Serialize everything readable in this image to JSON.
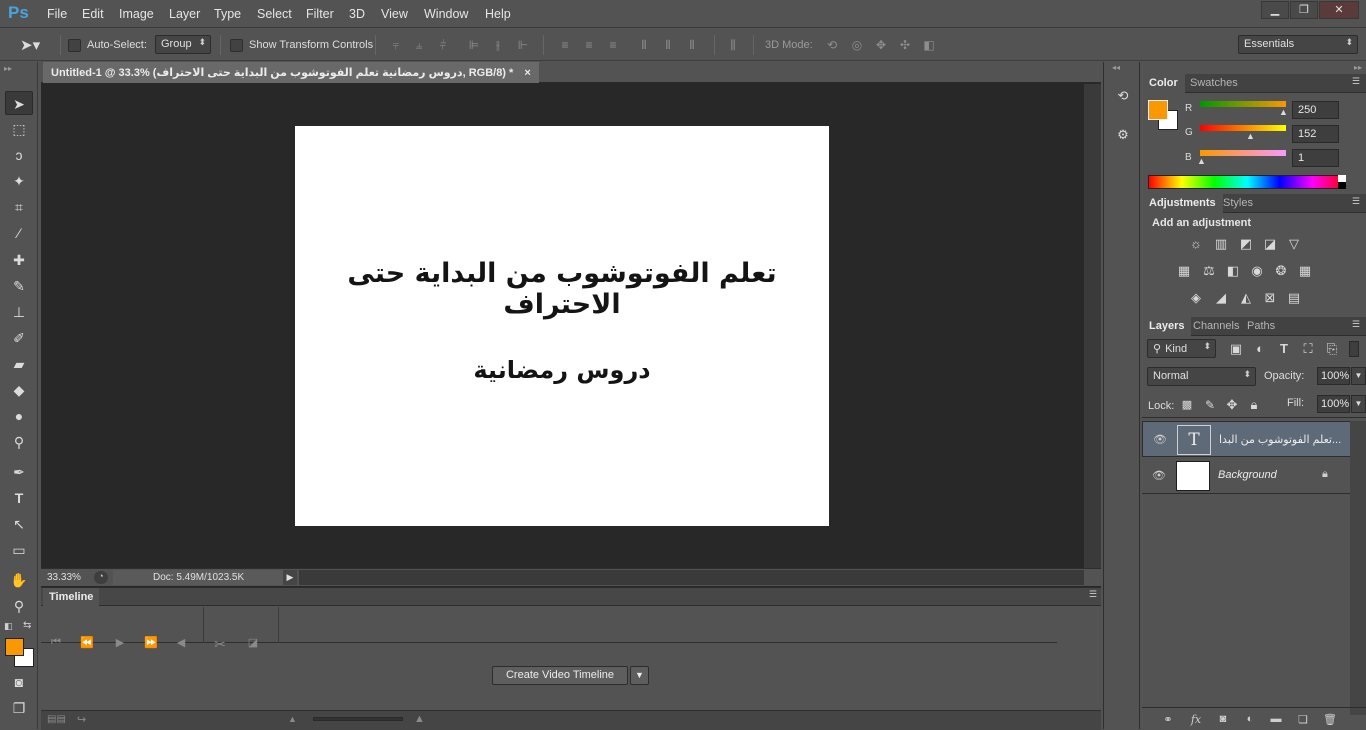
{
  "app": {
    "logo": "Ps",
    "menu": [
      "File",
      "Edit",
      "Image",
      "Layer",
      "Type",
      "Select",
      "Filter",
      "3D",
      "View",
      "Window",
      "Help"
    ],
    "window_controls": [
      "▁",
      "❐",
      "✕"
    ]
  },
  "options": {
    "auto_select_label": "Auto-Select:",
    "auto_select_value": "Group",
    "show_transform_label": "Show Transform Controls",
    "mode_3d_label": "3D Mode:",
    "workspace": "Essentials"
  },
  "document": {
    "tab_title": "Untitled-1 @ 33.3% (دروس رمضانية  تعلم الفوتوشوب من البداية حتى الاحتراف, RGB/8) *",
    "tab_close": "×",
    "canvas_title": "تعلم الفوتوشوب من البداية حتى الاحتراف",
    "canvas_subtitle": "دروس رمضانية",
    "zoom": "33.33%",
    "doc_info": "Doc: 5.49M/1023.5K"
  },
  "timeline": {
    "tab": "Timeline",
    "create_button": "Create Video Timeline"
  },
  "color_panel": {
    "tabs": [
      "Color",
      "Swatches"
    ],
    "foreground": "#fa9801",
    "background": "#ffffff",
    "r_label": "R",
    "g_label": "G",
    "b_label": "B",
    "r": "250",
    "g": "152",
    "b": "1"
  },
  "adjustments_panel": {
    "tabs": [
      "Adjustments",
      "Styles"
    ],
    "heading": "Add an adjustment"
  },
  "layers_panel": {
    "tabs": [
      "Layers",
      "Channels",
      "Paths"
    ],
    "filter_kind": "Kind",
    "blend_mode": "Normal",
    "opacity_label": "Opacity:",
    "opacity": "100%",
    "lock_label": "Lock:",
    "fill_label": "Fill:",
    "fill": "100%",
    "layers": [
      {
        "name": "تعلم الفوتوشوب من البدا...",
        "type": "text",
        "thumb": "T"
      },
      {
        "name": "Background",
        "type": "background"
      }
    ]
  }
}
